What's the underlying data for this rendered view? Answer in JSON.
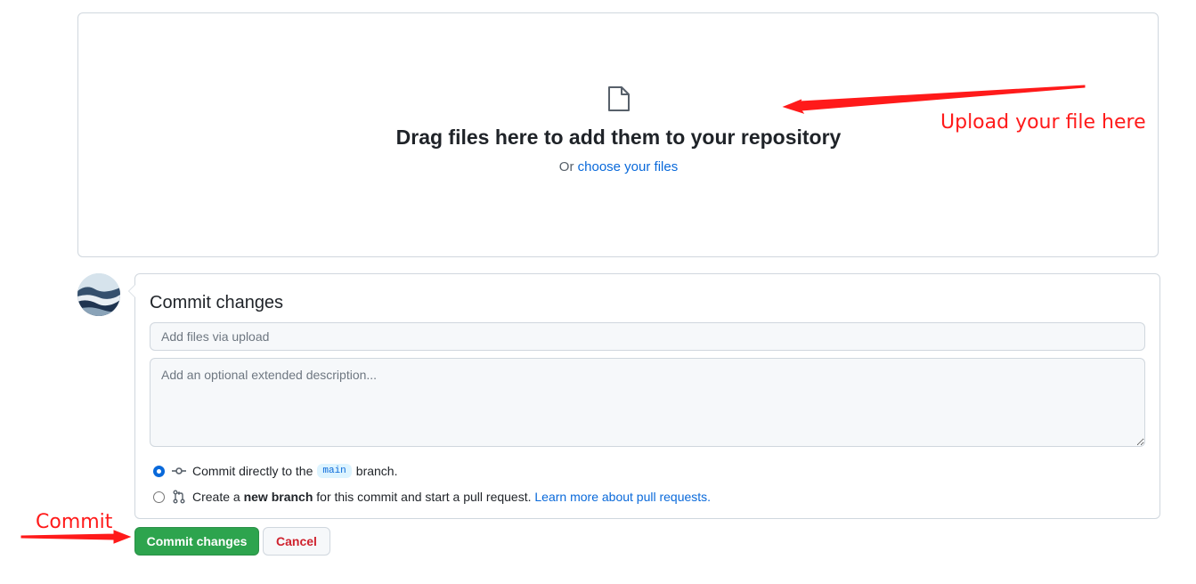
{
  "dropzone": {
    "icon": "file-icon",
    "title": "Drag files here to add them to your repository",
    "subtitle_prefix": "Or",
    "choose_link": "choose your files"
  },
  "commit": {
    "title": "Commit changes",
    "summary_placeholder": "Add files via upload",
    "description_placeholder": "Add an optional extended description...",
    "option_direct": {
      "text_before": "Commit directly to the",
      "branch": "main",
      "text_after": "branch.",
      "icon": "git-commit-icon",
      "selected": true
    },
    "option_new_branch": {
      "text_create": "Create a",
      "text_bold": "new branch",
      "text_after": "for this commit and start a pull request.",
      "link": "Learn more about pull requests.",
      "icon": "git-pull-request-icon",
      "selected": false
    }
  },
  "buttons": {
    "commit_label": "Commit changes",
    "cancel_label": "Cancel"
  },
  "annotations": {
    "upload_note": "Upload your file here",
    "commit_note": "Commit",
    "color": "#ff1a1a"
  },
  "colors": {
    "accent_link": "#0969da",
    "primary_button": "#2da44e",
    "danger_text": "#cf222e"
  }
}
